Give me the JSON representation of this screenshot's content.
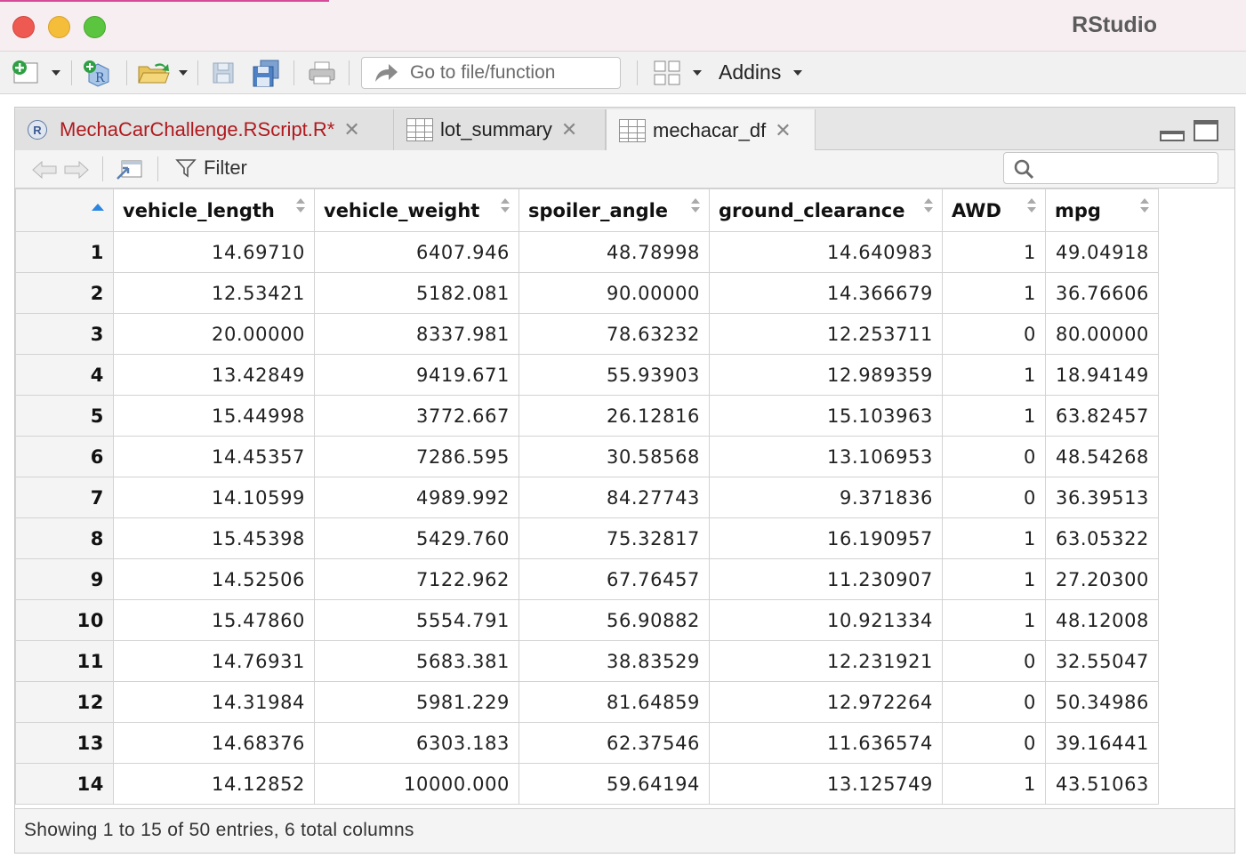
{
  "window": {
    "title": "RStudio"
  },
  "toolbar": {
    "goto_placeholder": "Go to file/function",
    "addins_label": "Addins"
  },
  "tabs": [
    {
      "label": "MechaCarChallenge.RScript.R*",
      "icon": "r-script-icon"
    },
    {
      "label": "lot_summary",
      "icon": "table-icon"
    },
    {
      "label": "mechacar_df",
      "icon": "table-icon",
      "active": true
    }
  ],
  "viewer": {
    "filter_label": "Filter",
    "search_value": "",
    "columns": [
      "vehicle_length",
      "vehicle_weight",
      "spoiler_angle",
      "ground_clearance",
      "AWD",
      "mpg"
    ],
    "rows": [
      [
        "1",
        "14.69710",
        "6407.946",
        "48.78998",
        "14.640983",
        "1",
        "49.04918"
      ],
      [
        "2",
        "12.53421",
        "5182.081",
        "90.00000",
        "14.366679",
        "1",
        "36.76606"
      ],
      [
        "3",
        "20.00000",
        "8337.981",
        "78.63232",
        "12.253711",
        "0",
        "80.00000"
      ],
      [
        "4",
        "13.42849",
        "9419.671",
        "55.93903",
        "12.989359",
        "1",
        "18.94149"
      ],
      [
        "5",
        "15.44998",
        "3772.667",
        "26.12816",
        "15.103963",
        "1",
        "63.82457"
      ],
      [
        "6",
        "14.45357",
        "7286.595",
        "30.58568",
        "13.106953",
        "0",
        "48.54268"
      ],
      [
        "7",
        "14.10599",
        "4989.992",
        "84.27743",
        "9.371836",
        "0",
        "36.39513"
      ],
      [
        "8",
        "15.45398",
        "5429.760",
        "75.32817",
        "16.190957",
        "1",
        "63.05322"
      ],
      [
        "9",
        "14.52506",
        "7122.962",
        "67.76457",
        "11.230907",
        "1",
        "27.20300"
      ],
      [
        "10",
        "15.47860",
        "5554.791",
        "56.90882",
        "10.921334",
        "1",
        "48.12008"
      ],
      [
        "11",
        "14.76931",
        "5683.381",
        "38.83529",
        "12.231921",
        "0",
        "32.55047"
      ],
      [
        "12",
        "14.31984",
        "5981.229",
        "81.64859",
        "12.972264",
        "0",
        "50.34986"
      ],
      [
        "13",
        "14.68376",
        "6303.183",
        "62.37546",
        "11.636574",
        "0",
        "39.16441"
      ],
      [
        "14",
        "14.12852",
        "10000.000",
        "59.64194",
        "13.125749",
        "1",
        "43.51063"
      ]
    ],
    "status": "Showing 1 to 15 of 50 entries, 6 total columns"
  },
  "colors": {
    "script_tab_text": "#b0191e",
    "sort_accent": "#2a86e0"
  }
}
